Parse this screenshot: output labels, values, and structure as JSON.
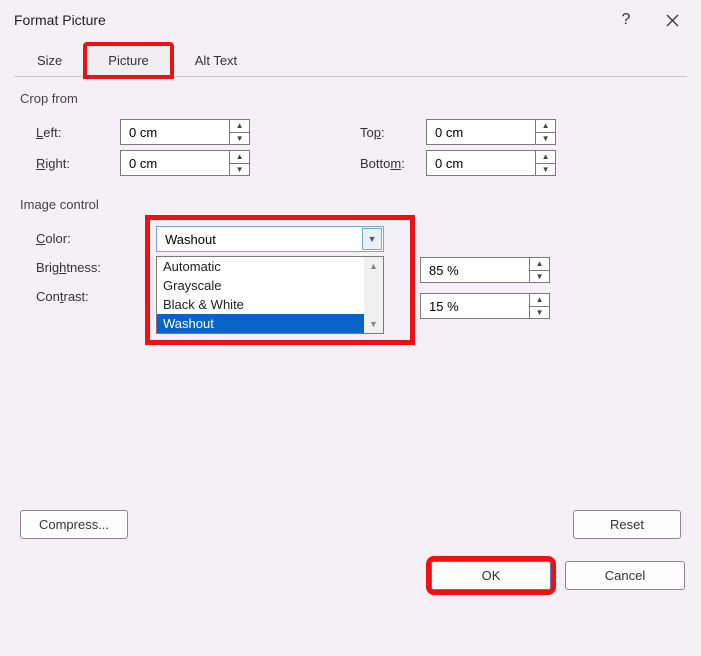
{
  "title": "Format Picture",
  "tabs": {
    "size": "Size",
    "picture": "Picture",
    "alttext": "Alt Text"
  },
  "crop": {
    "section": "Crop from",
    "left_lbl_pre": "",
    "left_lbl_u": "L",
    "left_lbl_post": "eft:",
    "left_val": "0 cm",
    "right_lbl_pre": "",
    "right_lbl_u": "R",
    "right_lbl_post": "ight:",
    "right_val": "0 cm",
    "top_lbl_pre": "To",
    "top_lbl_u": "p",
    "top_lbl_post": ":",
    "top_val": "0 cm",
    "bottom_lbl_pre": "Botto",
    "bottom_lbl_u": "m",
    "bottom_lbl_post": ":",
    "bottom_val": "0 cm"
  },
  "imgctrl": {
    "section": "Image control",
    "color_lbl_pre": "",
    "color_lbl_u": "C",
    "color_lbl_post": "olor:",
    "color_val": "Washout",
    "bright_lbl_pre": "Brig",
    "bright_lbl_u": "h",
    "bright_lbl_post": "tness:",
    "bright_val": "85 %",
    "contrast_lbl_pre": "Con",
    "contrast_lbl_u": "t",
    "contrast_lbl_post": "rast:",
    "contrast_val": "15 %",
    "options": {
      "0": "Automatic",
      "1": "Grayscale",
      "2": "Black & White",
      "3": "Washout"
    }
  },
  "buttons": {
    "compress": "Compress...",
    "reset": "Reset",
    "ok": "OK",
    "cancel": "Cancel"
  }
}
